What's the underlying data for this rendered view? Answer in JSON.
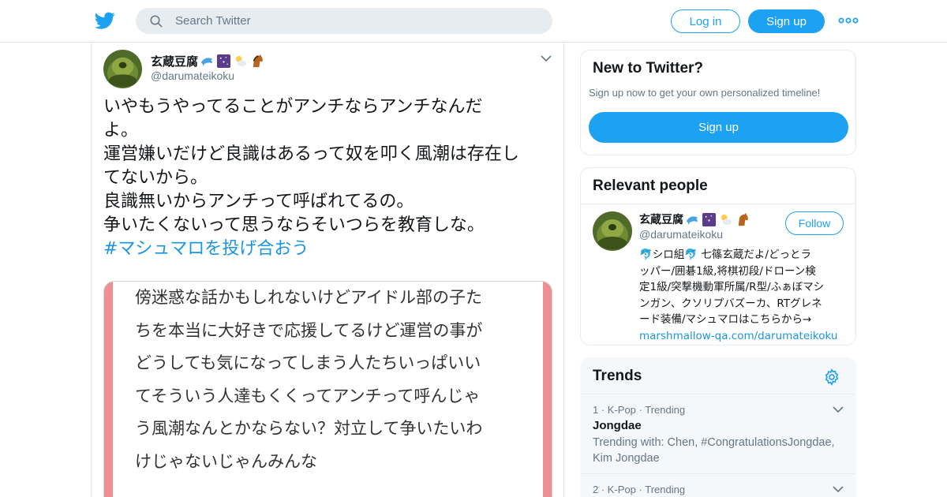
{
  "header": {
    "search_placeholder": "Search Twitter",
    "login_label": "Log in",
    "signup_label": "Sign up",
    "more_icon": "more-dots-icon"
  },
  "tweet": {
    "display_name": "玄蔵豆腐",
    "name_emojis": [
      "dolphin",
      "night-sky",
      "cloud-sun",
      "horse"
    ],
    "handle": "@darumateikoku",
    "text_lines": [
      "いやもうやってることがアンチならアンチなんだ",
      "よ。",
      "運営嫌いだけど良識はあるって奴を叩く風潮は存在し",
      "てないから。",
      "良識無いからアンチって呼ばれてるの。",
      "争いたくないって思うならそいつらを教育しな。"
    ],
    "hashtag": "#マシュマロを投げ合おう",
    "media_text_lines": [
      "傍迷惑な話かもしれないけどアイドル部の子た",
      "ちを本当に大好きで応援してるけど運営の事が",
      "どうしても気になってしまう人たちいっぱいい",
      "てそういう人達もくくってアンチって呼んじゃ",
      "う風潮なんとかならない？対立して争いたいわ",
      "けじゃないじゃんみんな"
    ]
  },
  "sidebar": {
    "new_to_twitter": {
      "title": "New to Twitter?",
      "subtitle": "Sign up now to get your own personalized timeline!",
      "button": "Sign up"
    },
    "relevant_people": {
      "title": "Relevant people",
      "person": {
        "display_name": "玄蔵豆腐",
        "handle": "@darumateikoku",
        "follow_label": "Follow",
        "bio_lines": [
          "🐬シロ組🐬 七篠玄蔵だよ/どっとラ",
          "ッパー/囲碁1級,将棋初段/ドローン検",
          "定1級/突撃機動軍所属/R型/ふぁぼマシ",
          "ンガン、クソリプバズーカ、RTグレネ",
          "ード装備/マシュマロはこちらから→"
        ],
        "bio_link": "marshmallow-qa.com/darumateikoku"
      }
    },
    "trends": {
      "title": "Trends",
      "items": [
        {
          "rank": "1",
          "category": "K-Pop",
          "status": "Trending",
          "meta": "1 · K-Pop · Trending",
          "name": "Jongdae",
          "trending_with_lines": [
            "Trending with: Chen, #CongratulationsJongdae,",
            "Kim Jongdae"
          ]
        },
        {
          "rank": "2",
          "category": "K-Pop",
          "status": "Trending",
          "meta": "2 · K-Pop · Trending"
        }
      ]
    }
  },
  "colors": {
    "brand_blue": "#1da1f2",
    "link_blue": "#1b95e0",
    "muted_gray": "#657786",
    "media_border_pink": "#f08f93"
  }
}
